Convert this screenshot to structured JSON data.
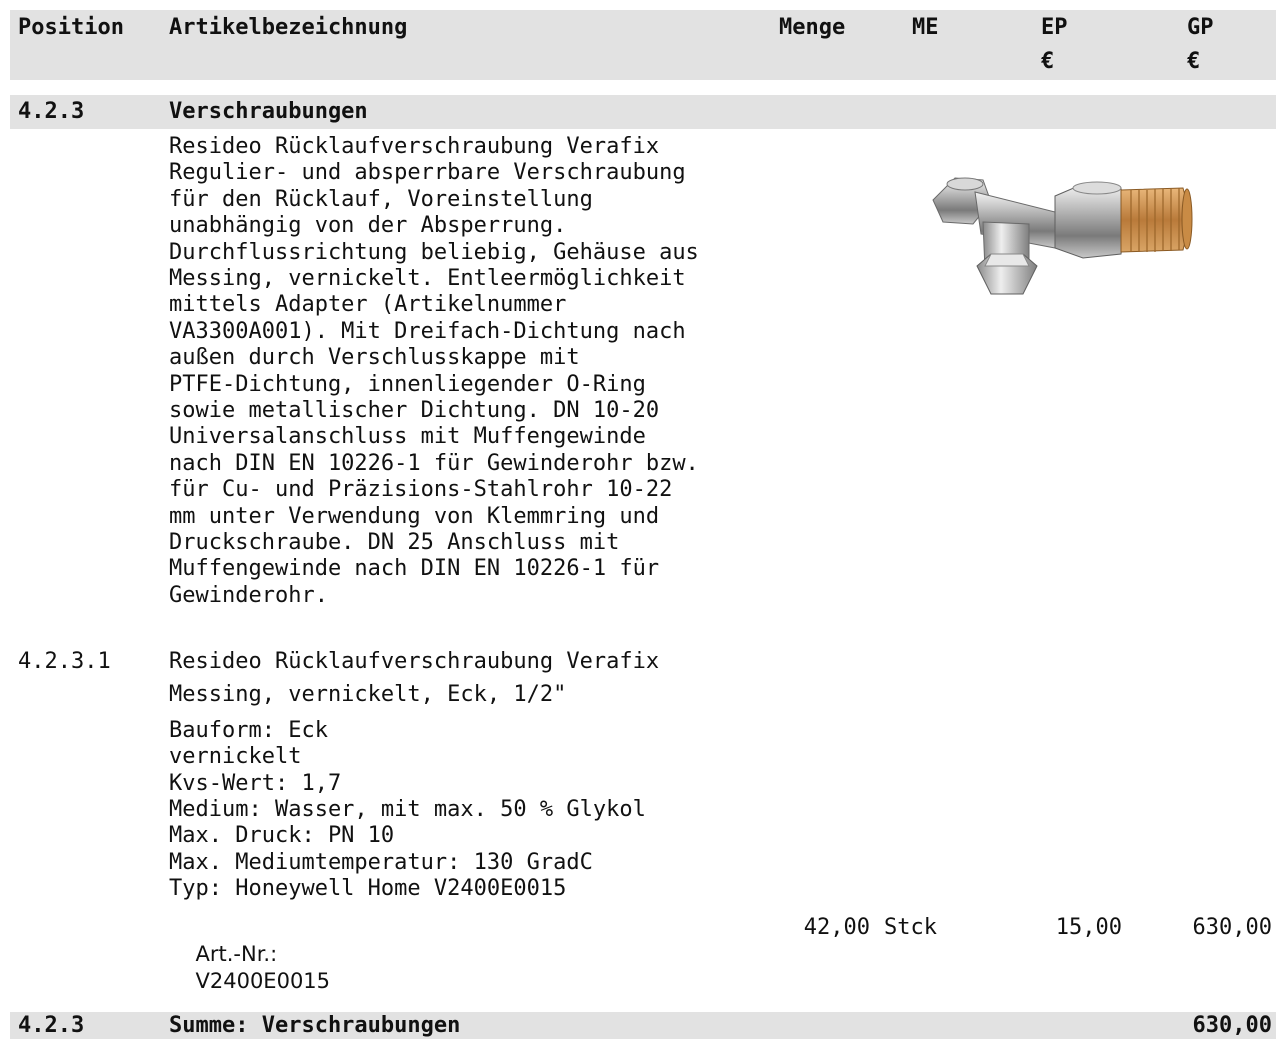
{
  "header": {
    "position": "Position",
    "description": "Artikelbezeichnung",
    "quantity": "Menge",
    "unit": "ME",
    "unit_price": "EP",
    "unit_price_currency": "€",
    "total_price": "GP",
    "total_price_currency": "€"
  },
  "section": {
    "number": "4.2.3",
    "title": "Verschraubungen",
    "description_lines": [
      "Resideo Rücklaufverschraubung Verafix",
      "Regulier- und absperrbare Verschraubung",
      "für den Rücklauf, Voreinstellung",
      "unabhängig von der Absperrung.",
      "Durchflussrichtung beliebig, Gehäuse aus",
      "Messing, vernickelt. Entleermöglichkeit",
      "mittels Adapter (Artikelnummer",
      "VA3300A001). Mit Dreifach-Dichtung nach",
      "außen durch Verschlusskappe mit",
      "PTFE-Dichtung, innenliegender O-Ring",
      "sowie metallischer Dichtung. DN 10-20",
      "Universalanschluss mit Muffengewinde",
      "nach DIN EN 10226-1 für Gewinderohr bzw.",
      "für Cu- und Präzisions-Stahlrohr 10-22",
      "mm unter Verwendung von Klemmring und",
      "Druckschraube. DN 25 Anschluss mit",
      "Muffengewinde nach DIN EN 10226-1 für",
      "Gewinderohr."
    ]
  },
  "item": {
    "number": "4.2.3.1",
    "title_line1": "Resideo Rücklaufverschraubung Verafix",
    "title_line2": "Messing, vernickelt, Eck, 1/2\"",
    "spec_lines": [
      "Bauform: Eck",
      "vernickelt",
      "Kvs-Wert: 1,7",
      "Medium: Wasser, mit max. 50 % Glykol",
      "Max. Druck: PN 10",
      "Max. Mediumtemperatur: 130 GradC",
      "Typ: Honeywell Home V2400E0015"
    ],
    "article_label": "Art.-Nr.:",
    "article_number": "V2400E0015",
    "quantity": "42,00",
    "unit": "Stck",
    "unit_price": "15,00",
    "total_price": "630,00"
  },
  "summary": {
    "number": "4.2.3",
    "label": "Summe: Verschraubungen",
    "total": "630,00"
  },
  "colors": {
    "band": "#e2e2e2",
    "text": "#111111"
  },
  "icons": {
    "product_image": "valve-image"
  }
}
